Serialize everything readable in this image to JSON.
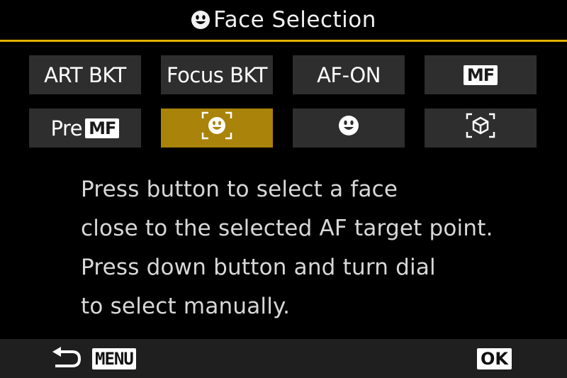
{
  "header": {
    "icon": "face-icon",
    "title": "Face Selection",
    "accent_color": "#e2b100"
  },
  "modes": [
    {
      "label": "ART BKT",
      "selected": false
    },
    {
      "label": "Focus BKT",
      "selected": false
    },
    {
      "label": "AF-ON",
      "selected": false
    },
    {
      "label": "MF",
      "boxed": true,
      "selected": false
    },
    {
      "prefix": "Pre",
      "label": "MF",
      "boxed": true,
      "selected": false
    },
    {
      "icon": "face-select-frame-icon",
      "selected": true
    },
    {
      "icon": "face-icon",
      "selected": false
    },
    {
      "icon": "subject-detect-icon",
      "selected": false
    }
  ],
  "help_lines": [
    "Press button to select a face",
    "close to the selected AF target point.",
    "Press down button and turn dial",
    "to select manually."
  ],
  "footer": {
    "back_icon": "back-arrow-icon",
    "menu_label": "MENU",
    "ok_label": "OK"
  },
  "colors": {
    "tile": "#2e2e2e",
    "selected_tile": "#a9830a",
    "footer_bar": "#1f1f1f"
  }
}
